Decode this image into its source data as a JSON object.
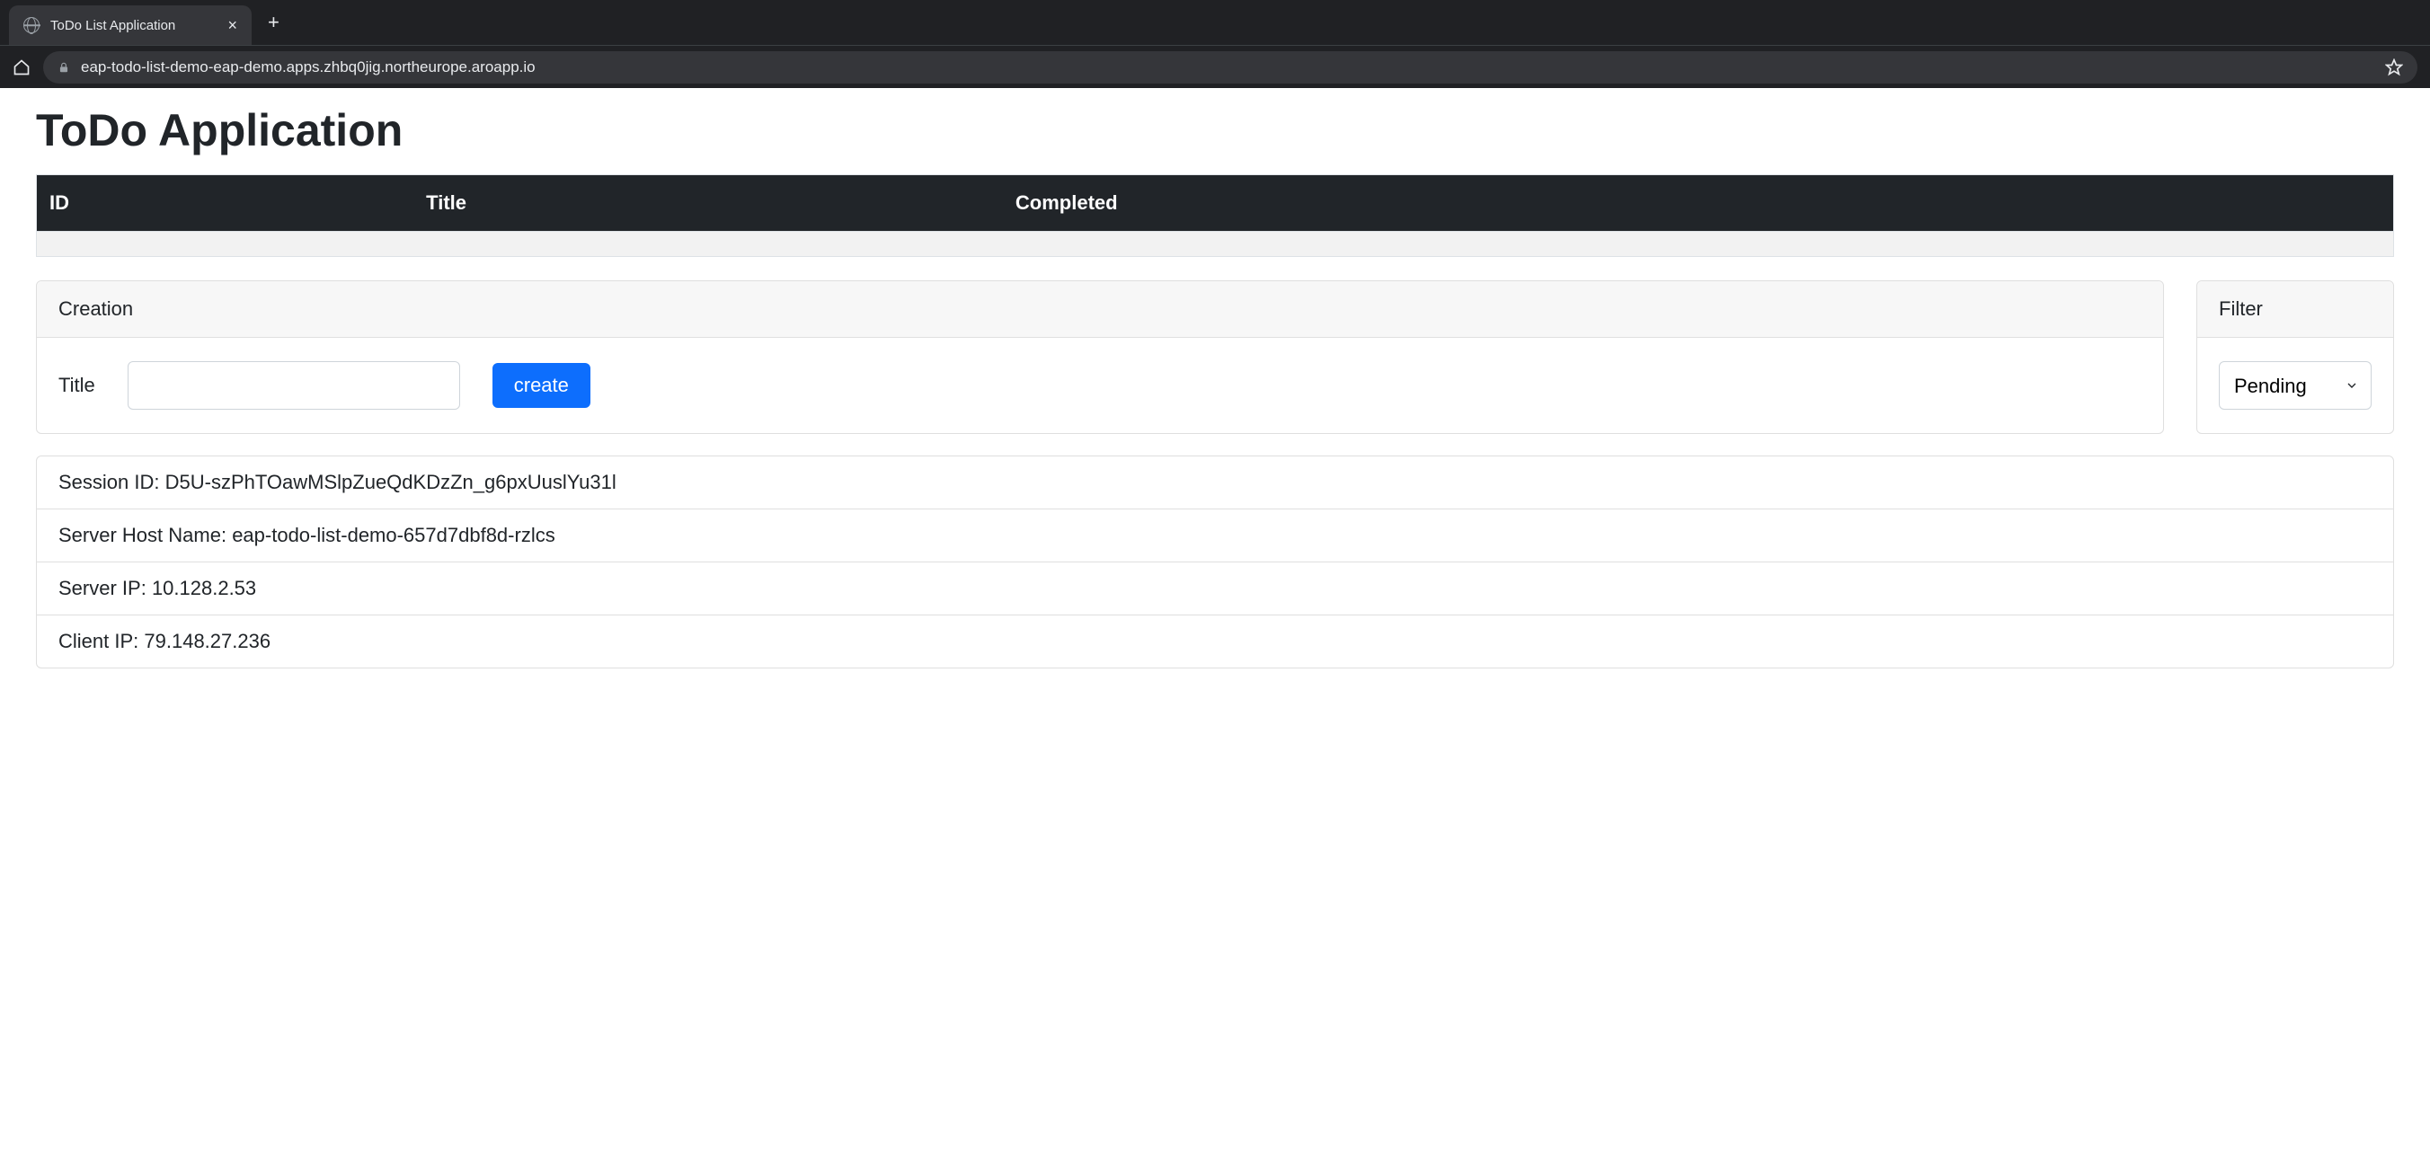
{
  "browser": {
    "tab_title": "ToDo List Application",
    "url": "eap-todo-list-demo-eap-demo.apps.zhbq0jig.northeurope.aroapp.io"
  },
  "page_title": "ToDo Application",
  "table": {
    "headers": {
      "id": "ID",
      "title": "Title",
      "completed": "Completed"
    }
  },
  "creation": {
    "header": "Creation",
    "title_label": "Title",
    "title_value": "",
    "create_button": "create"
  },
  "filter": {
    "header": "Filter",
    "selected": "Pending"
  },
  "info": {
    "session_label": "Session ID:",
    "session_value": "D5U-szPhTOawMSlpZueQdKDzZn_g6pxUuslYu31l",
    "host_label": "Server Host Name:",
    "host_value": "eap-todo-list-demo-657d7dbf8d-rzlcs",
    "server_ip_label": "Server IP:",
    "server_ip_value": "10.128.2.53",
    "client_ip_label": "Client IP:",
    "client_ip_value": "79.148.27.236"
  }
}
